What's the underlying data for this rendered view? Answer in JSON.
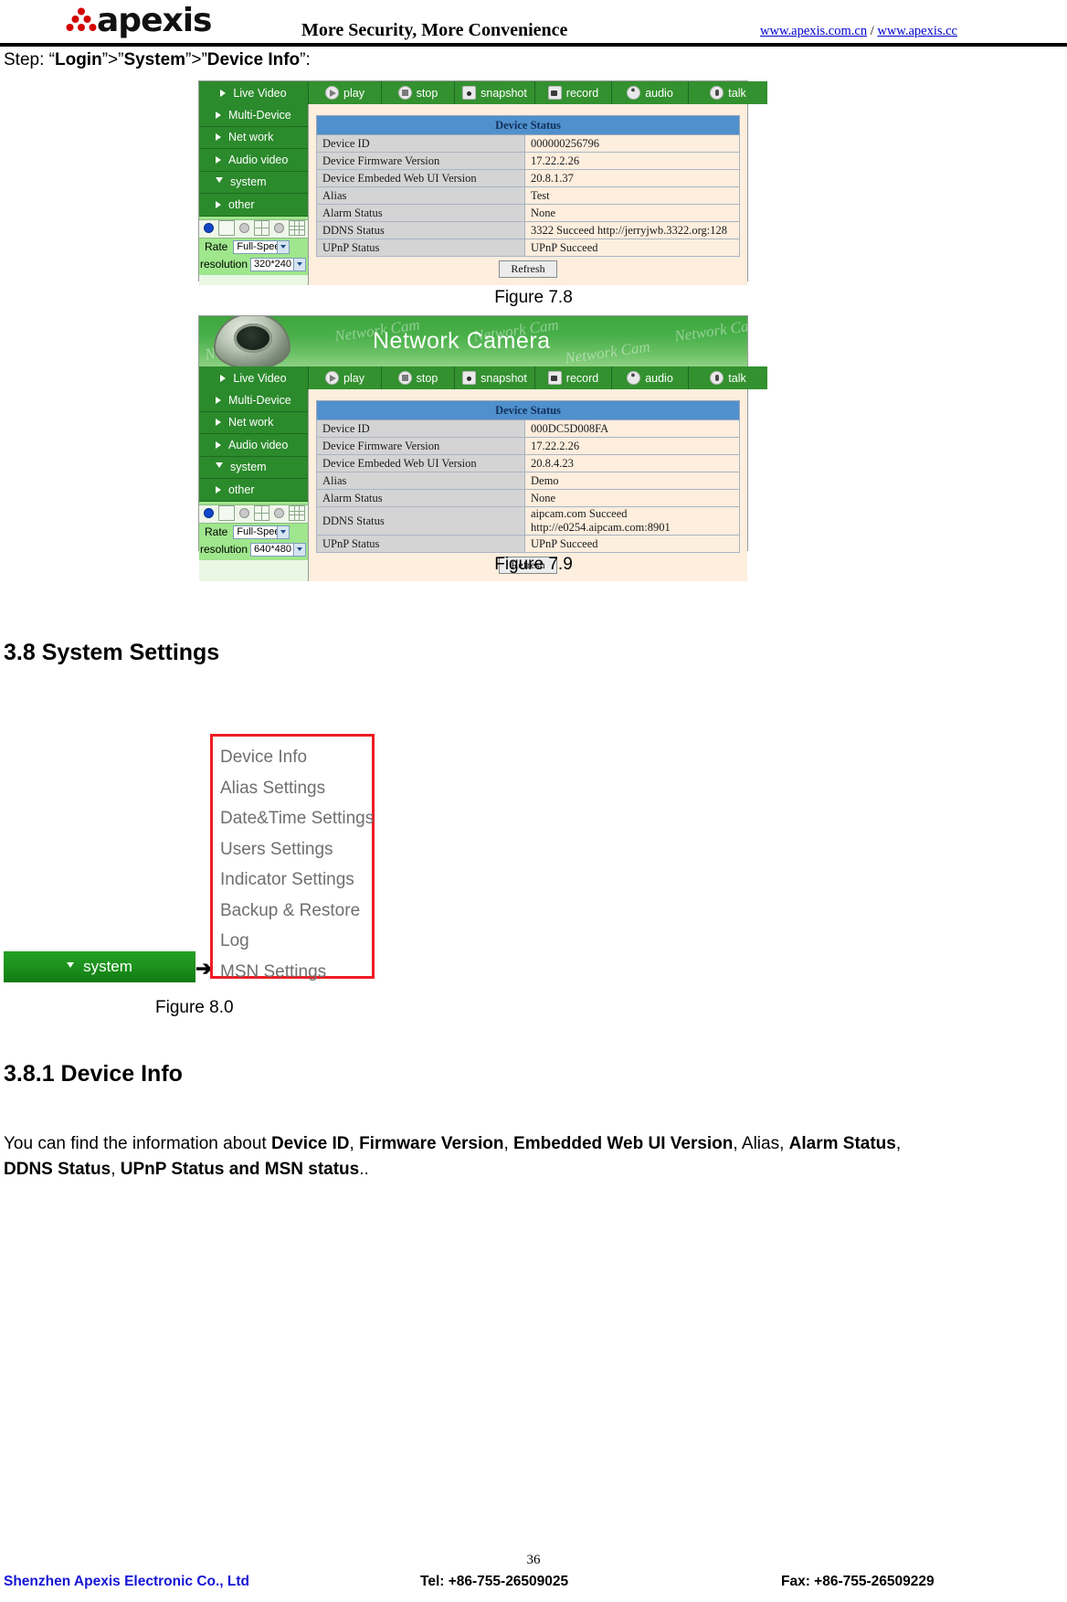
{
  "header": {
    "logo_text": "apexis",
    "slogan": "More Security, More Convenience",
    "link1": "www.apexis.com.cn",
    "link_separator": " / ",
    "link2": "www.apexis.cc"
  },
  "step": {
    "prefix": "Step: “",
    "b1": "Login",
    "mid1": "”>”",
    "b2": "System",
    "mid2": "”>”",
    "b3": "Device Info",
    "suffix": "”:"
  },
  "figure78": {
    "caption": "Figure 7.8",
    "toolbar": [
      {
        "icon": "play-icon",
        "label": "play"
      },
      {
        "icon": "stop-icon",
        "label": "stop"
      },
      {
        "icon": "snapshot-icon",
        "label": "snapshot"
      },
      {
        "icon": "record-icon",
        "label": "record"
      },
      {
        "icon": "audio-icon",
        "label": "audio"
      },
      {
        "icon": "talk-icon",
        "label": "talk"
      }
    ],
    "nav_label": "Live Video",
    "sidebar": [
      {
        "label": "Multi-Device",
        "expanded": false
      },
      {
        "label": "Net work",
        "expanded": false
      },
      {
        "label": "Audio video",
        "expanded": false
      },
      {
        "label": "system",
        "expanded": true
      },
      {
        "label": "other",
        "expanded": false
      }
    ],
    "rate_label": "Rate",
    "rate_value": "Full-Speed",
    "resolution_label": "resolution",
    "resolution_value": "320*240",
    "table_title": "Device Status",
    "rows": [
      {
        "key": "Device ID",
        "value": "000000256796"
      },
      {
        "key": "Device Firmware Version",
        "value": "17.22.2.26"
      },
      {
        "key": "Device Embeded Web UI Version",
        "value": "20.8.1.37"
      },
      {
        "key": "Alias",
        "value": "Test"
      },
      {
        "key": "Alarm Status",
        "value": "None"
      },
      {
        "key": "DDNS Status",
        "value": "3322 Succeed  http://jerryjwb.3322.org:128"
      },
      {
        "key": "UPnP Status",
        "value": "UPnP Succeed"
      }
    ],
    "refresh_label": "Refresh"
  },
  "figure79": {
    "caption": "Figure 7.9",
    "banner_title": "Network Camera",
    "watermark": "Network Cam",
    "toolbar": [
      {
        "icon": "play-icon",
        "label": "play"
      },
      {
        "icon": "stop-icon",
        "label": "stop"
      },
      {
        "icon": "snapshot-icon",
        "label": "snapshot"
      },
      {
        "icon": "record-icon",
        "label": "record"
      },
      {
        "icon": "audio-icon",
        "label": "audio"
      },
      {
        "icon": "talk-icon",
        "label": "talk"
      }
    ],
    "nav_label": "Live Video",
    "sidebar": [
      {
        "label": "Multi-Device",
        "expanded": false
      },
      {
        "label": "Net work",
        "expanded": false
      },
      {
        "label": "Audio video",
        "expanded": false
      },
      {
        "label": "system",
        "expanded": true
      },
      {
        "label": "other",
        "expanded": false
      }
    ],
    "rate_label": "Rate",
    "rate_value": "Full-Speed",
    "resolution_label": "resolution",
    "resolution_value": "640*480",
    "table_title": "Device Status",
    "rows": [
      {
        "key": "Device ID",
        "value": "000DC5D008FA"
      },
      {
        "key": "Device Firmware Version",
        "value": "17.22.2.26"
      },
      {
        "key": "Device Embeded Web UI Version",
        "value": "20.8.4.23"
      },
      {
        "key": "Alias",
        "value": "Demo"
      },
      {
        "key": "Alarm Status",
        "value": "None"
      },
      {
        "key": "DDNS Status",
        "value": "aipcam.com  Succeed  http://e0254.aipcam.com:8901"
      },
      {
        "key": "UPnP Status",
        "value": "UPnP Succeed"
      }
    ],
    "refresh_label": "Refresh"
  },
  "section38": {
    "title": "3.8 System Settings"
  },
  "figure80": {
    "caption": "Figure 8.0",
    "system_tab_label": "system",
    "arrow": "➔",
    "menu_items": [
      "Device Info",
      "Alias Settings",
      "Date&Time Settings",
      "Users Settings",
      "Indicator Settings",
      "Backup & Restore",
      "Log",
      "MSN Settings"
    ]
  },
  "section381": {
    "title": "3.8.1 Device Info",
    "para": {
      "t1": "You can find the information about ",
      "b1": "Device ID",
      "t2": ", ",
      "b2": "Firmware Version",
      "t3": ", ",
      "b3": "Embedded Web UI Version",
      "t4": ", Alias, ",
      "b4": "Alarm Status",
      "t5": ", ",
      "b5": "DDNS Status",
      "t6": ", ",
      "b6": "UPnP Status and MSN status",
      "t7": ".."
    }
  },
  "footer": {
    "page_number": "36",
    "company": "Shenzhen Apexis Electronic Co., Ltd",
    "tel": "Tel: +86-755-26509025",
    "fax": "Fax: +86-755-26509229"
  }
}
